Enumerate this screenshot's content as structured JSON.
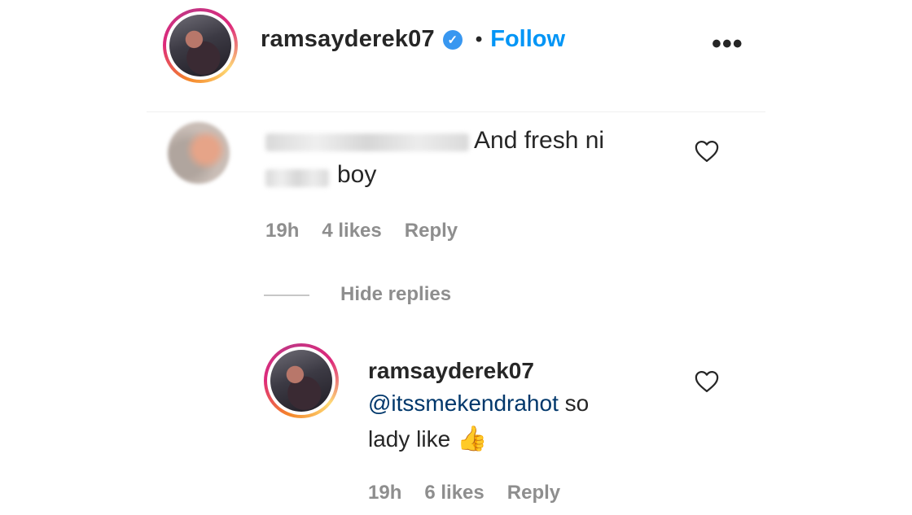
{
  "header": {
    "username": "ramsayderek07",
    "separator": "•",
    "follow_label": "Follow",
    "more_label": "•••"
  },
  "comment": {
    "text_line1": "And fresh ni",
    "text_line2": "boy",
    "time": "19h",
    "likes": "4 likes",
    "reply_label": "Reply"
  },
  "replies_toggle": {
    "label": "Hide replies"
  },
  "reply": {
    "username": "ramsayderek07",
    "mention": "@itssmekendrahot",
    "text_after_mention": " so",
    "text_line2": "lady like ",
    "emoji": "👍",
    "time": "19h",
    "likes": "6 likes",
    "reply_label": "Reply"
  },
  "colors": {
    "follow": "#0095f6",
    "verified": "#3897f0",
    "mention": "#00376b",
    "meta": "#8e8e8e"
  }
}
